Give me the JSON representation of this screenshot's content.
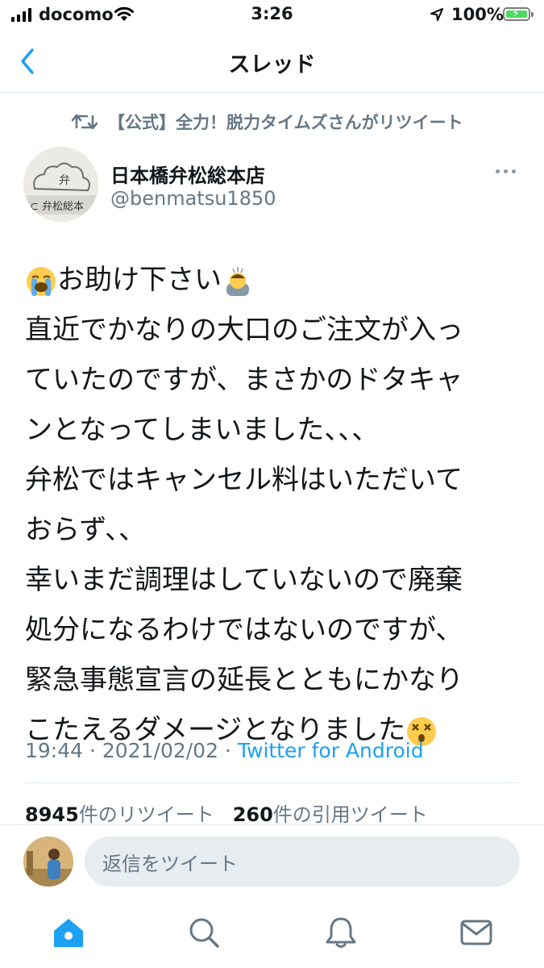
{
  "status_bar": {
    "carrier": "docomo",
    "time": "3:26",
    "battery": "100%"
  },
  "nav": {
    "title": "スレッド"
  },
  "retweet_banner": {
    "text": "【公式】全力！脱力タイムズさんがリツイート"
  },
  "tweet": {
    "author_name": "日本橋弁松総本店",
    "author_handle": "@benmatsu1850",
    "lines": [
      "お助け下さい",
      "直近でかなりの大口のご注文が入っ",
      "ていたのですが、まさかのドタキャ",
      "ンとなってしまいました、、、",
      "弁松ではキャンセル料はいただいて",
      "おらず、、",
      "幸いまだ調理はしていないので廃棄",
      "処分になるわけではないのですが、",
      "緊急事態宣言の延長とともにかなり",
      "こたえるダメージとなりました"
    ],
    "emojis": [
      "loudly-crying-face",
      "person-bowing",
      "dizzy-face"
    ],
    "time": "19:44",
    "date": "2021/02/02",
    "separator": "·",
    "source": "Twitter for Android",
    "retweet_count": "8945",
    "retweet_label": "件のリツイート",
    "quote_count": "260",
    "quote_label": "件の引用ツイート"
  },
  "reply": {
    "placeholder": "返信をツイート"
  },
  "tab_bar": {
    "items": [
      "home-icon",
      "search-icon",
      "notifications-icon",
      "messages-icon"
    ],
    "active": "home-icon"
  },
  "colors": {
    "accent": "#1da1f2",
    "secondary_text": "#657786",
    "divider": "#e1e8ed"
  }
}
